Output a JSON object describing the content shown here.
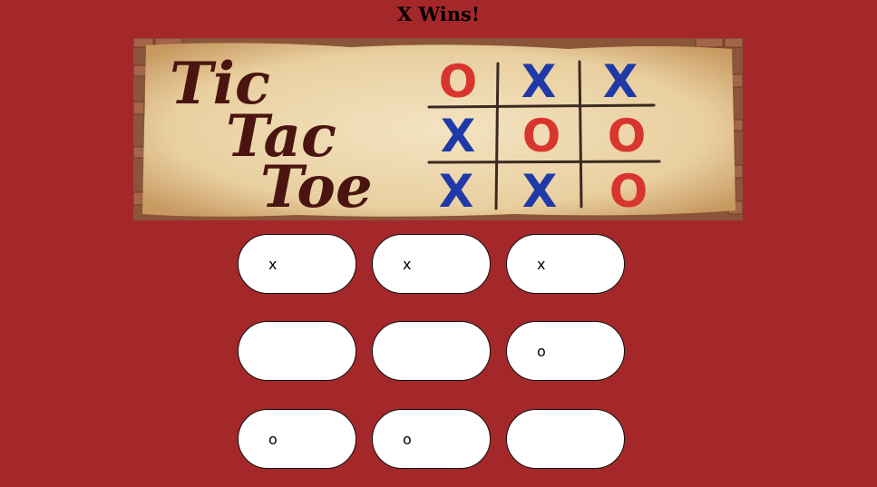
{
  "status": {
    "message": "X Wins!"
  },
  "banner": {
    "title_lines": [
      "Tic",
      "Tac",
      "Toe"
    ],
    "decor_grid": [
      "O",
      "X",
      "X",
      "X",
      "O",
      "O",
      "X",
      "X",
      "O"
    ],
    "colors": {
      "x": "#1f3aa8",
      "o": "#d8352e",
      "title": "#4a1510"
    }
  },
  "board": {
    "cells": [
      "x",
      "x",
      "x",
      "",
      "",
      "o",
      "o",
      "o",
      ""
    ]
  },
  "colors": {
    "background": "#a4282a",
    "cell": "#ffffff"
  }
}
